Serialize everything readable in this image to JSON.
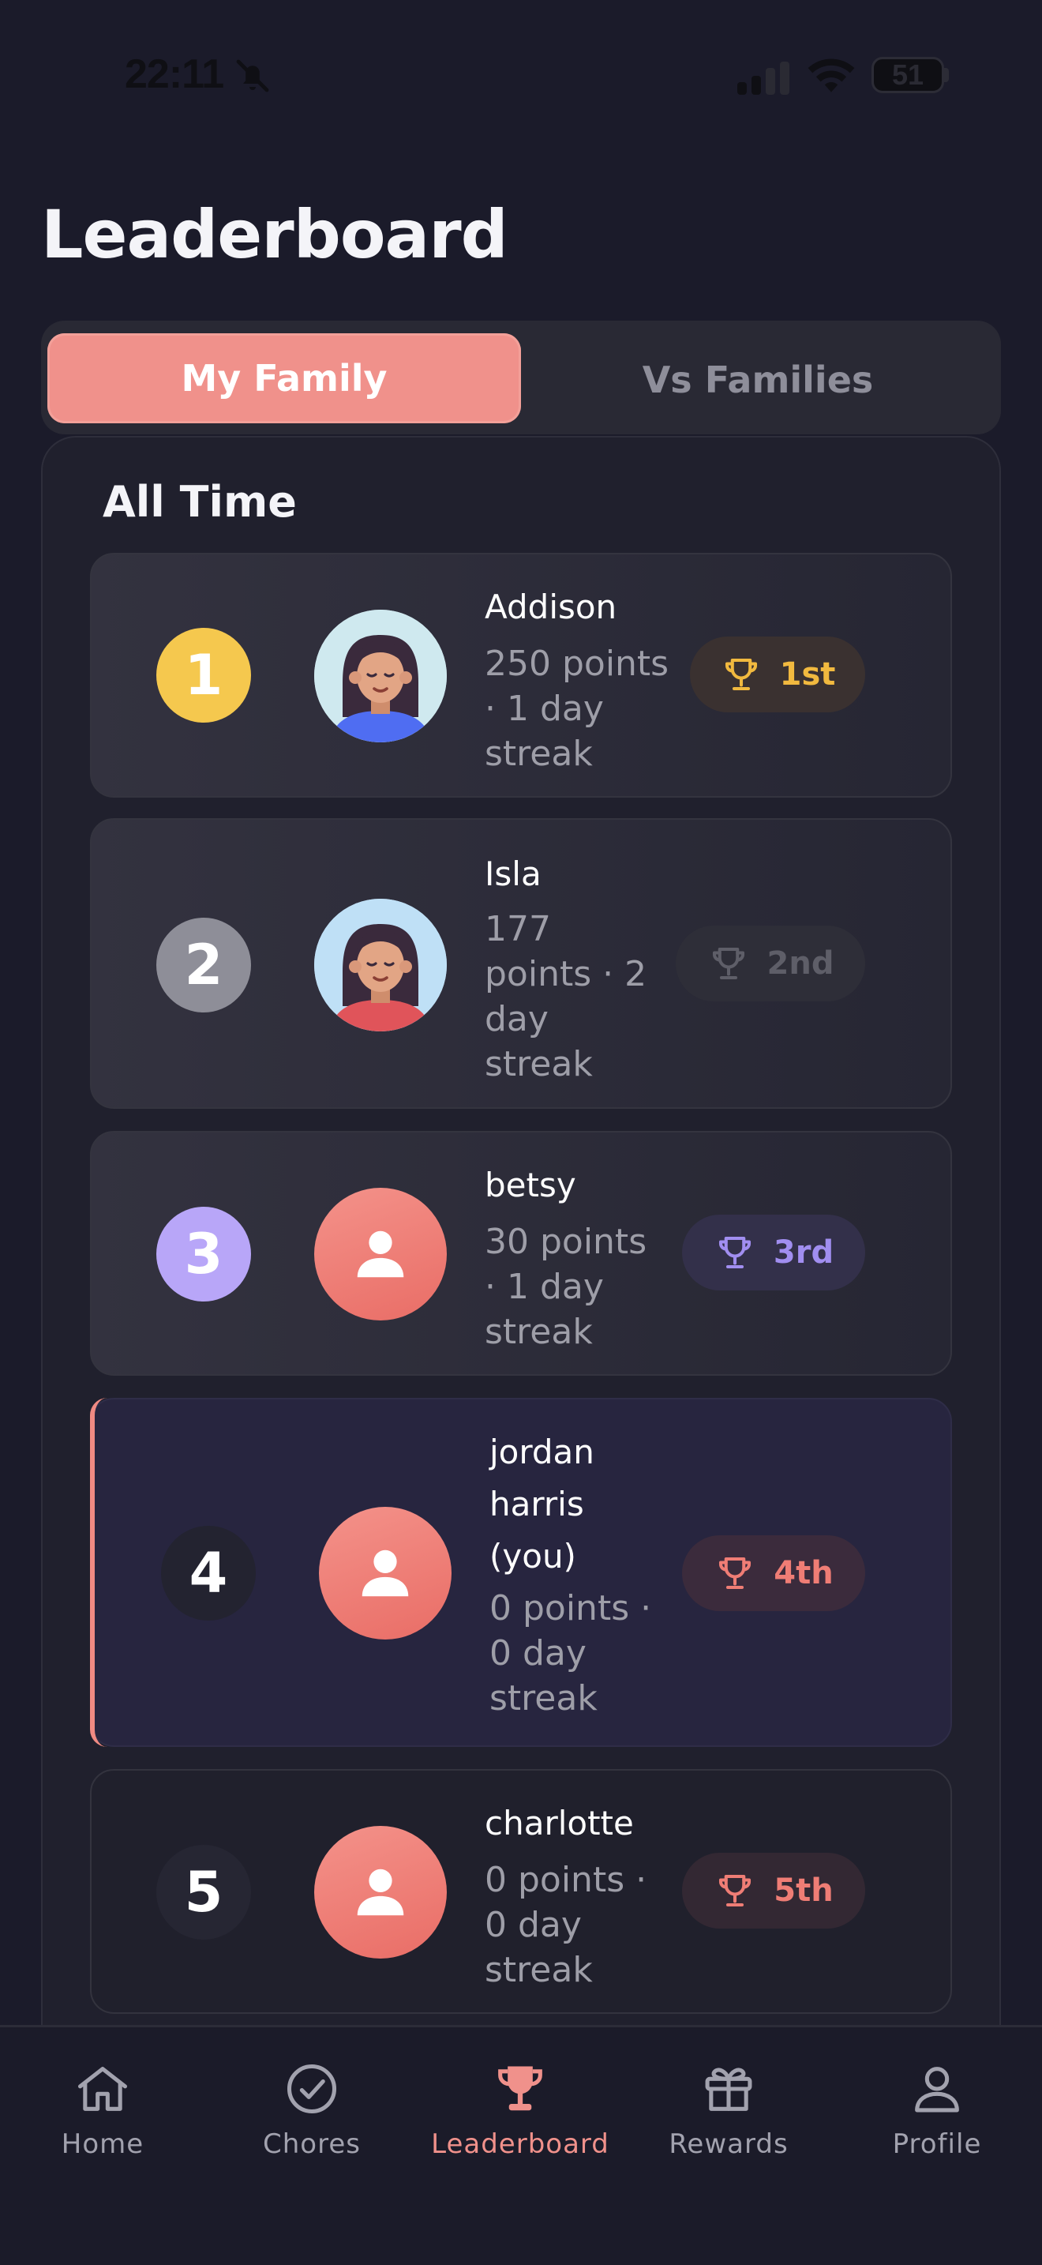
{
  "status_bar": {
    "time": "22:11",
    "battery": "51"
  },
  "page": {
    "title": "Leaderboard"
  },
  "segments": {
    "my_family": "My Family",
    "vs_families": "Vs Families",
    "selected": "My Family"
  },
  "section": {
    "title": "All Time"
  },
  "leaderboard": [
    {
      "rank": "1",
      "name": "Addison",
      "stats": "250 points · 1 day streak",
      "badge": "1st",
      "avatar": "girl-avatar-dark-hair-blue-shirt",
      "rank_color": "#f5c84e",
      "badge_color": "#f1b93f"
    },
    {
      "rank": "2",
      "name": "Isla",
      "stats": "177 points · 2 day streak",
      "badge": "2nd",
      "avatar": "girl-avatar-dark-hair-red-shirt",
      "rank_color": "#8e8e98",
      "badge_color": "#5e5e68"
    },
    {
      "rank": "3",
      "name": "betsy",
      "stats": "30 points · 1 day streak",
      "badge": "3rd",
      "avatar": "generic-user-icon",
      "rank_color": "#b8a6f8",
      "badge_color": "#a18ef0"
    },
    {
      "rank": "4",
      "name": "jordan harris (you)",
      "stats": "0 points · 0 day streak",
      "badge": "4th",
      "avatar": "generic-user-icon",
      "rank_color": "#232330",
      "badge_color": "#ef7d75",
      "is_you": true
    },
    {
      "rank": "5",
      "name": "charlotte",
      "stats": "0 points · 0 day streak",
      "badge": "5th",
      "avatar": "generic-user-icon",
      "rank_color": "#262633",
      "badge_color": "#ef7d75"
    }
  ],
  "tabbar": {
    "items": [
      {
        "label": "Home",
        "icon": "home-icon"
      },
      {
        "label": "Chores",
        "icon": "check-circle-icon"
      },
      {
        "label": "Leaderboard",
        "icon": "trophy-icon",
        "active": true
      },
      {
        "label": "Rewards",
        "icon": "gift-icon"
      },
      {
        "label": "Profile",
        "icon": "person-icon"
      }
    ]
  },
  "colors": {
    "accent": "#f0918b",
    "background": "#1b1b2a",
    "card": "#20202d"
  }
}
